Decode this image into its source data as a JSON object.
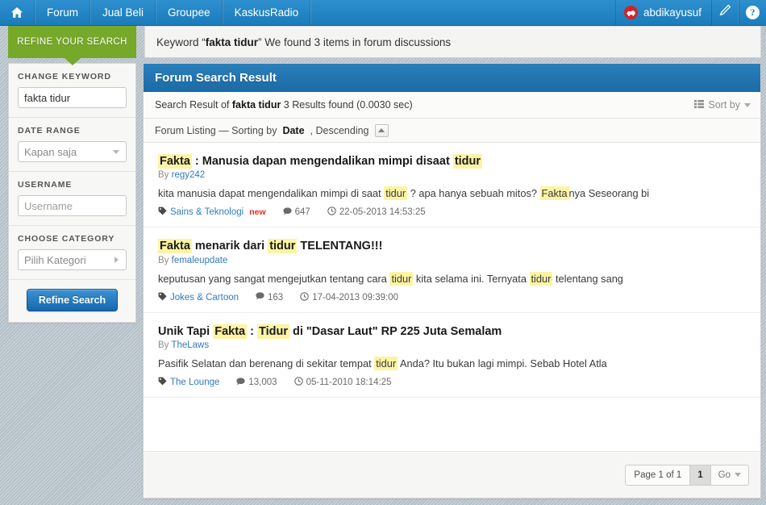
{
  "topnav": {
    "home_icon": "home-icon",
    "items": [
      "Forum",
      "Jual Beli",
      "Groupee",
      "KaskusRadio"
    ],
    "username": "abdikayusuf",
    "compose_icon": "pencil-icon",
    "help_icon": "help-icon",
    "help_glyph": "?"
  },
  "refine_tab": {
    "label": "REFINE YOUR SEARCH"
  },
  "keyword_bar": {
    "prefix": "Keyword “",
    "keyword": "fakta tidur",
    "suffix": "” We found 3 items in forum discussions"
  },
  "sidebar": {
    "groups": [
      {
        "label": "CHANGE KEYWORD",
        "type": "input",
        "value": "fakta tidur",
        "placeholder": ""
      },
      {
        "label": "DATE RANGE",
        "type": "select",
        "value": "Kapan saja"
      },
      {
        "label": "USERNAME",
        "type": "input",
        "value": "",
        "placeholder": "Username"
      },
      {
        "label": "CHOOSE CATEGORY",
        "type": "select-right",
        "value": "Pilih Kategori"
      }
    ],
    "button": "Refine Search"
  },
  "panel": {
    "title": "Forum Search Result",
    "result_prefix": "Search Result of ",
    "result_keyword": "fakta tidur",
    "result_suffix": " 3 Results found (0.0030 sec)",
    "sort_by": "Sort by",
    "sort_icon": "list-icon",
    "listing_prefix": "Forum Listing — Sorting by ",
    "listing_sort_field": "Date",
    "listing_sort_dir": ", Descending",
    "collapse_icon": "collapse-up-icon"
  },
  "results": [
    {
      "title_parts": [
        {
          "t": "Fakta",
          "hl": true
        },
        {
          "t": " : Manusia dapan mengendalikan mimpi disaat ",
          "hl": false
        },
        {
          "t": "tidur",
          "hl": true
        }
      ],
      "by_label": "By ",
      "author": "regy242",
      "snippet_parts": [
        {
          "t": "kita manusia dapat mengendalikan mimpi di saat ",
          "hl": false
        },
        {
          "t": "tidur",
          "hl": true
        },
        {
          "t": " ? apa hanya sebuah mitos? ",
          "hl": false
        },
        {
          "t": "Fakta",
          "hl": true
        },
        {
          "t": "nya Seseorang bi",
          "hl": false
        }
      ],
      "category": "Sains & Teknologi",
      "new_badge": "new",
      "replies": "647",
      "date": "22-05-2013 14:53:25"
    },
    {
      "title_parts": [
        {
          "t": "Fakta",
          "hl": true
        },
        {
          "t": " menarik dari ",
          "hl": false
        },
        {
          "t": "tidur",
          "hl": true
        },
        {
          "t": " TELENTANG!!!",
          "hl": false
        }
      ],
      "by_label": "By ",
      "author": "femaleupdate",
      "snippet_parts": [
        {
          "t": "keputusan yang sangat mengejutkan tentang cara ",
          "hl": false
        },
        {
          "t": "tidur",
          "hl": true
        },
        {
          "t": " kita selama ini. Ternyata ",
          "hl": false
        },
        {
          "t": "tidur",
          "hl": true
        },
        {
          "t": " telentang sang",
          "hl": false
        }
      ],
      "category": "Jokes & Cartoon",
      "new_badge": "",
      "replies": "163",
      "date": "17-04-2013 09:39:00"
    },
    {
      "title_parts": [
        {
          "t": "Unik Tapi ",
          "hl": false
        },
        {
          "t": "Fakta",
          "hl": true
        },
        {
          "t": " : ",
          "hl": false
        },
        {
          "t": "Tidur",
          "hl": true
        },
        {
          "t": " di \"Dasar Laut\" RP 225 Juta Semalam",
          "hl": false
        }
      ],
      "by_label": "By ",
      "author": "TheLaws",
      "snippet_parts": [
        {
          "t": "Pasifik Selatan dan berenang di sekitar tempat ",
          "hl": false
        },
        {
          "t": "tidur",
          "hl": true
        },
        {
          "t": " Anda? Itu bukan lagi mimpi. Sebab Hotel Atla",
          "hl": false
        }
      ],
      "category": "The Lounge",
      "new_badge": "",
      "replies": "13,003",
      "date": "05-11-2010 18:14:25"
    }
  ],
  "pager": {
    "page_label": "Page 1 of 1",
    "current": "1",
    "go": "Go"
  },
  "colors": {
    "nav_blue": "#1b7cbb",
    "panel_blue": "#1a6ba6",
    "green_tab": "#76a82a",
    "link_blue": "#2f7bc0",
    "highlight": "#fcf4a3",
    "new_red": "#e03028",
    "page_bg": "#b4c0c8"
  }
}
